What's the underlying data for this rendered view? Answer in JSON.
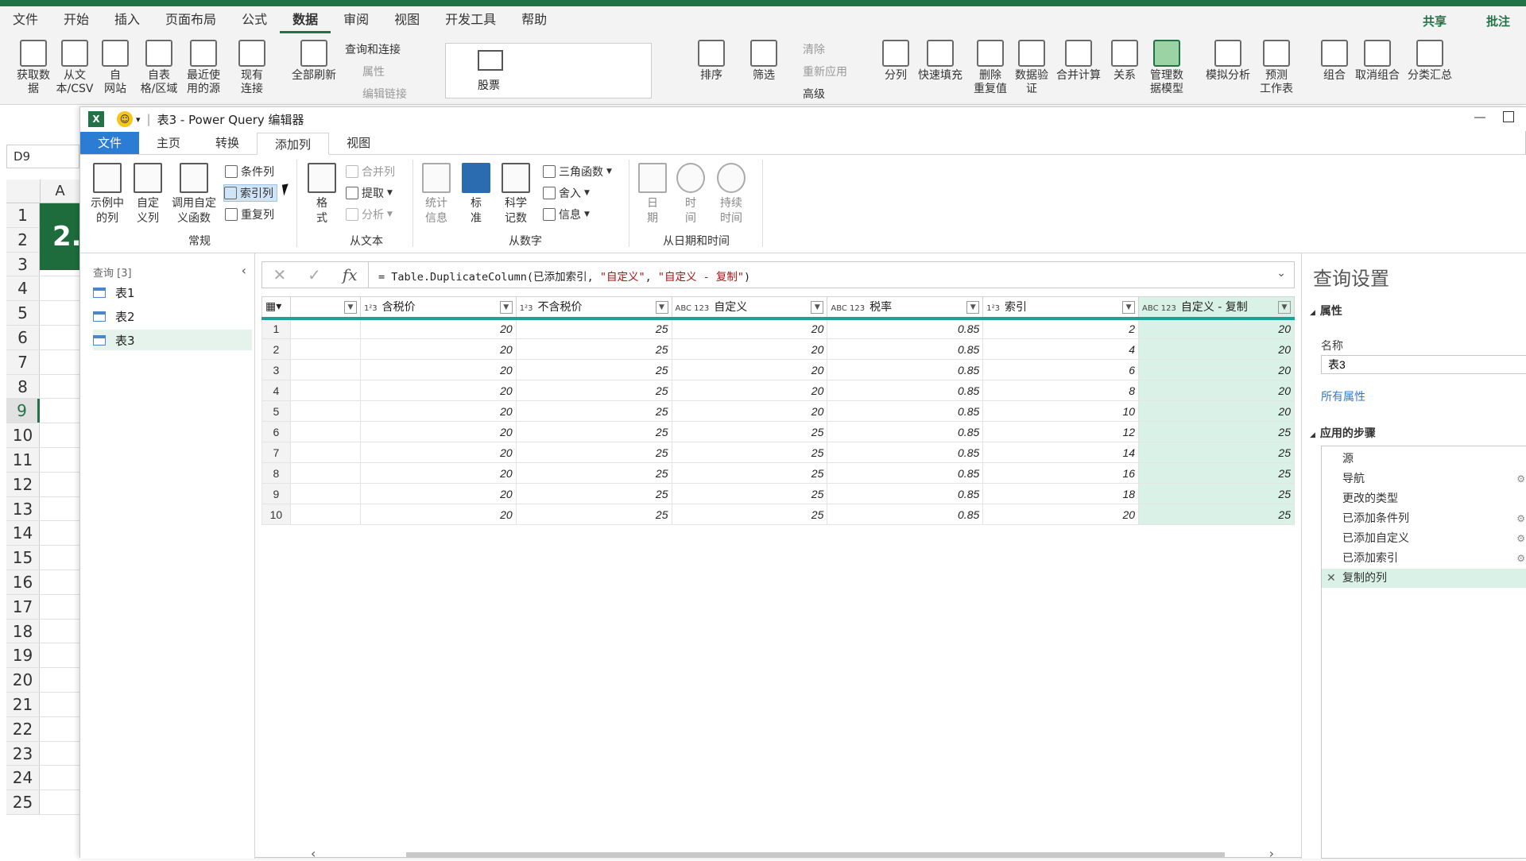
{
  "excel": {
    "menu": [
      "文件",
      "开始",
      "插入",
      "页面布局",
      "公式",
      "数据",
      "审阅",
      "视图",
      "开发工具",
      "帮助"
    ],
    "active_menu": "数据",
    "share": "共享",
    "comment": "批注",
    "ribbon": {
      "get_data": "获取数\n据",
      "from_text": "从文\n本/CSV",
      "from_web": "自\n网站",
      "from_table": "自表\n格/区域",
      "recent": "最近使\n用的源",
      "existing": "现有\n连接",
      "refresh_all": "全部刷新",
      "queries_conn": "查询和连接",
      "properties": "属性",
      "edit_links": "编辑链接",
      "stocks": "股票",
      "sort": "排序",
      "filter": "筛选",
      "clear": "清除",
      "reapply": "重新应用",
      "advanced": "高级",
      "split": "分列",
      "flash_fill": "快速填充",
      "remove_dup": "删除\n重复值",
      "validation": "数据验\n证",
      "consolidate": "合并计算",
      "relations": "关系",
      "data_model": "管理数\n据模型",
      "what_if": "模拟分析",
      "forecast": "预测\n工作表",
      "group": "组合",
      "ungroup": "取消组合",
      "subtotal": "分类汇总"
    },
    "name_box": "D9",
    "col_a": "A",
    "rows": [
      "1",
      "2",
      "3",
      "4",
      "5",
      "6",
      "7",
      "8",
      "9",
      "10",
      "11",
      "12",
      "13",
      "14",
      "15",
      "16",
      "17",
      "18",
      "19",
      "20",
      "21",
      "22",
      "23",
      "24",
      "25"
    ],
    "selected_row": "9",
    "green_cell": "2."
  },
  "pq": {
    "title": "表3 - Power Query 编辑器",
    "tabs": [
      "文件",
      "主页",
      "转换",
      "添加列",
      "视图"
    ],
    "active_tab": "添加列",
    "ribbon": {
      "example_col": "示例中\n的列",
      "custom_col": "自定\n义列",
      "invoke_fn": "调用自定\n义函数",
      "cond_col": "条件列",
      "index_col": "索引列",
      "dup_col": "重复列",
      "format": "格\n式",
      "merge_cols": "合并列",
      "extract": "提取",
      "parse": "分析",
      "statistics": "统计\n信息",
      "standard": "标\n准",
      "scientific": "科学\n记数",
      "trig": "三角函数",
      "rounding": "舍入",
      "info": "信息",
      "date": "日\n期",
      "time": "时\n间",
      "duration": "持续\n时间",
      "grp_general": "常规",
      "grp_text": "从文本",
      "grp_number": "从数字",
      "grp_datetime": "从日期和时间"
    },
    "queries": {
      "header": "查询 [3]",
      "items": [
        "表1",
        "表2",
        "表3"
      ],
      "selected": "表3"
    },
    "formula": {
      "prefix": "= Table.DuplicateColumn(已添加索引, ",
      "arg1": "\"自定义\"",
      "comma": ", ",
      "arg2": "\"自定义 - 复制\"",
      "suffix": ")"
    },
    "columns": [
      {
        "type": "",
        "name": ""
      },
      {
        "type": "1²3",
        "name": "含税价"
      },
      {
        "type": "1²3",
        "name": "不含税价"
      },
      {
        "type": "ABC\n123",
        "name": "自定义"
      },
      {
        "type": "ABC\n123",
        "name": "税率"
      },
      {
        "type": "1²3",
        "name": "索引"
      },
      {
        "type": "ABC\n123",
        "name": "自定义 - 复制"
      }
    ],
    "rows": [
      [
        "1",
        "",
        "20",
        "25",
        "20",
        "0.85",
        "2",
        "20"
      ],
      [
        "2",
        "",
        "20",
        "25",
        "20",
        "0.85",
        "4",
        "20"
      ],
      [
        "3",
        "",
        "20",
        "25",
        "20",
        "0.85",
        "6",
        "20"
      ],
      [
        "4",
        "",
        "20",
        "25",
        "20",
        "0.85",
        "8",
        "20"
      ],
      [
        "5",
        "",
        "20",
        "25",
        "20",
        "0.85",
        "10",
        "20"
      ],
      [
        "6",
        "",
        "20",
        "25",
        "25",
        "0.85",
        "12",
        "25"
      ],
      [
        "7",
        "",
        "20",
        "25",
        "25",
        "0.85",
        "14",
        "25"
      ],
      [
        "8",
        "",
        "20",
        "25",
        "25",
        "0.85",
        "16",
        "25"
      ],
      [
        "9",
        "",
        "20",
        "25",
        "25",
        "0.85",
        "18",
        "25"
      ],
      [
        "10",
        "",
        "20",
        "25",
        "25",
        "0.85",
        "20",
        "25"
      ]
    ],
    "settings": {
      "title": "查询设置",
      "properties": "属性",
      "name_label": "名称",
      "name_value": "表3",
      "all_props": "所有属性",
      "steps_header": "应用的步骤",
      "steps": [
        "源",
        "导航",
        "更改的类型",
        "已添加条件列",
        "已添加自定义",
        "已添加索引",
        "复制的列"
      ],
      "selected_step": "复制的列"
    }
  }
}
